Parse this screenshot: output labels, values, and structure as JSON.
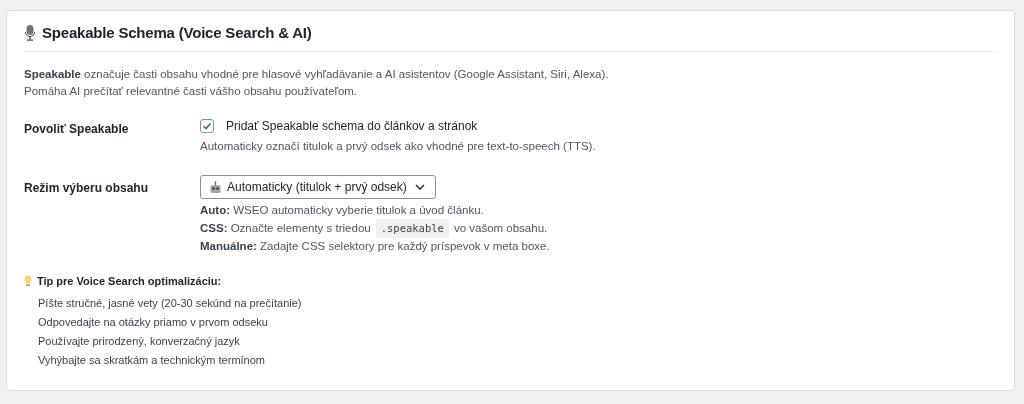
{
  "panel": {
    "title": "Speakable Schema (Voice Search & AI)",
    "description": [
      "**Speakable** označuje časti obsahu vhodné pre hlasové vyhľadávanie a AI asistentov (Google Assistant, Siri, Alexa).",
      "Pomáha AI prečítať relevantné časti vášho obsahu používateľom."
    ],
    "settings": [
      {
        "kind": "checkbox",
        "label": "Povoliť Speakable",
        "checkbox_label": "Pridať Speakable schema do článkov a stránok",
        "checked": true,
        "help": [
          {
            "text": "Automaticky označí titulok a prvý odsek ako vhodné pre text-to-speech (TTS)."
          }
        ]
      },
      {
        "kind": "select",
        "label": "Režim výberu obsahu",
        "value": "Automaticky (titulok + prvý odsek)",
        "help": [
          {
            "text": "**Auto:** WSEO automaticky vyberie titulok a úvod článku."
          },
          {
            "text": "**CSS:** Označte elementy s triedou",
            "code": ".speakable",
            "after": "vo vašom obsahu."
          },
          {
            "text": "**Manuálne:** Zadajte CSS selektory pre každý príspevok v meta boxe."
          }
        ]
      }
    ],
    "tip": {
      "title": "Tip pre Voice Search optimalizáciu:",
      "items": [
        "Píšte stručné, jasné vety (20-30 sekúnd na prečítanie)",
        "Odpovedajte na otázky priamo v prvom odseku",
        "Používajte prirodzený, konverzačný jazyk",
        "Vyhýbajte sa skratkám a technickým termínom"
      ]
    }
  }
}
